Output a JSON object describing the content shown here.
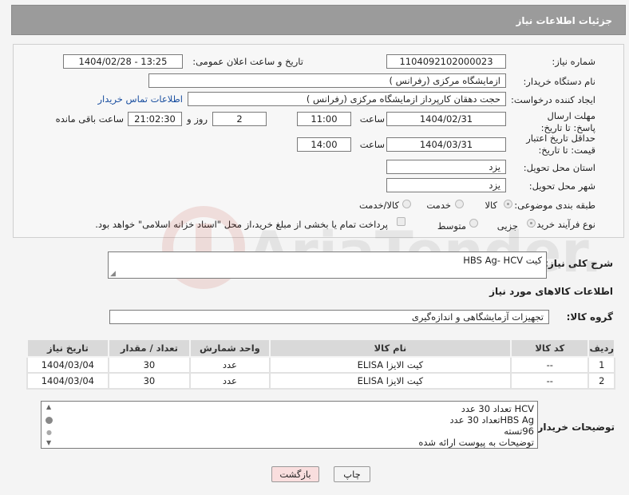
{
  "header": {
    "title": "جزئیات اطلاعات نیاز"
  },
  "form": {
    "need_number_label": "شماره نیاز:",
    "need_number": "1104092102000023",
    "announce_label": "تاریخ و ساعت اعلان عمومی:",
    "announce_value": "1404/02/28 - 13:25",
    "buyer_org_label": "نام دستگاه خریدار:",
    "buyer_org": "ازمایشگاه مرکزی (رفرانس )",
    "creator_label": "ایجاد کننده درخواست:",
    "creator": "حجت دهقان کارپرداز ازمایشگاه مرکزی (رفرانس )",
    "contact_link": "اطلاعات تماس خریدار",
    "reply_deadline_label": "مهلت ارسال پاسخ: تا تاریخ:",
    "reply_date": "1404/02/31",
    "time_label": "ساعت",
    "reply_time": "11:00",
    "days_value": "2",
    "days_label": "روز و",
    "remaining_time": "21:02:30",
    "remaining_label": "ساعت باقی مانده",
    "price_validity_label": "حداقل تاریخ اعتبار قیمت: تا تاریخ:",
    "price_date": "1404/03/31",
    "price_time_label": "ساعت",
    "price_time": "14:00",
    "province_label": "استان محل تحویل:",
    "province": "یزد",
    "city_label": "شهر محل تحویل:",
    "city": "یزد",
    "category_label": "طبقه بندی موضوعی:",
    "category_options": [
      "کالا",
      "خدمت",
      "کالا/خدمت"
    ],
    "process_label": "نوع فرآیند خرید :",
    "process_options": [
      "جزیی",
      "متوسط"
    ],
    "payment_note": "پرداخت تمام یا بخشی از مبلغ خرید،از محل \"اسناد خزانه اسلامی\" خواهد بود."
  },
  "need_desc": {
    "label": "شرح کلی نیاز:",
    "value": "کیت HBS Ag- HCV"
  },
  "goods_info": {
    "title": "اطلاعات کالاهای مورد نیاز"
  },
  "goods_group": {
    "label": "گروه کالا:",
    "value": "تجهیزات آزمایشگاهی و اندازه‌گیری"
  },
  "table": {
    "headers": [
      "ردیف",
      "کد کالا",
      "نام کالا",
      "واحد شمارش",
      "تعداد / مقدار",
      "تاریخ نیاز"
    ],
    "rows": [
      [
        "1",
        "--",
        "کیت الایزا ELISA",
        "عدد",
        "30",
        "1404/03/04"
      ],
      [
        "2",
        "--",
        "کیت الایزا ELISA",
        "عدد",
        "30",
        "1404/03/04"
      ]
    ]
  },
  "buyer_notes": {
    "label": "توضیحات خریدار:",
    "lines": [
      "HCV  تعداد 30 عدد",
      "HBS Agتعداد 30 عدد",
      "96تسته",
      "توضیحات به پیوست ارائه شده"
    ]
  },
  "buttons": {
    "print": "چاپ",
    "back": "بازگشت"
  },
  "colors": {
    "header_bg": "#9b9b9b",
    "back_button_bg": "#f9dede",
    "link": "#1a4fa0"
  }
}
